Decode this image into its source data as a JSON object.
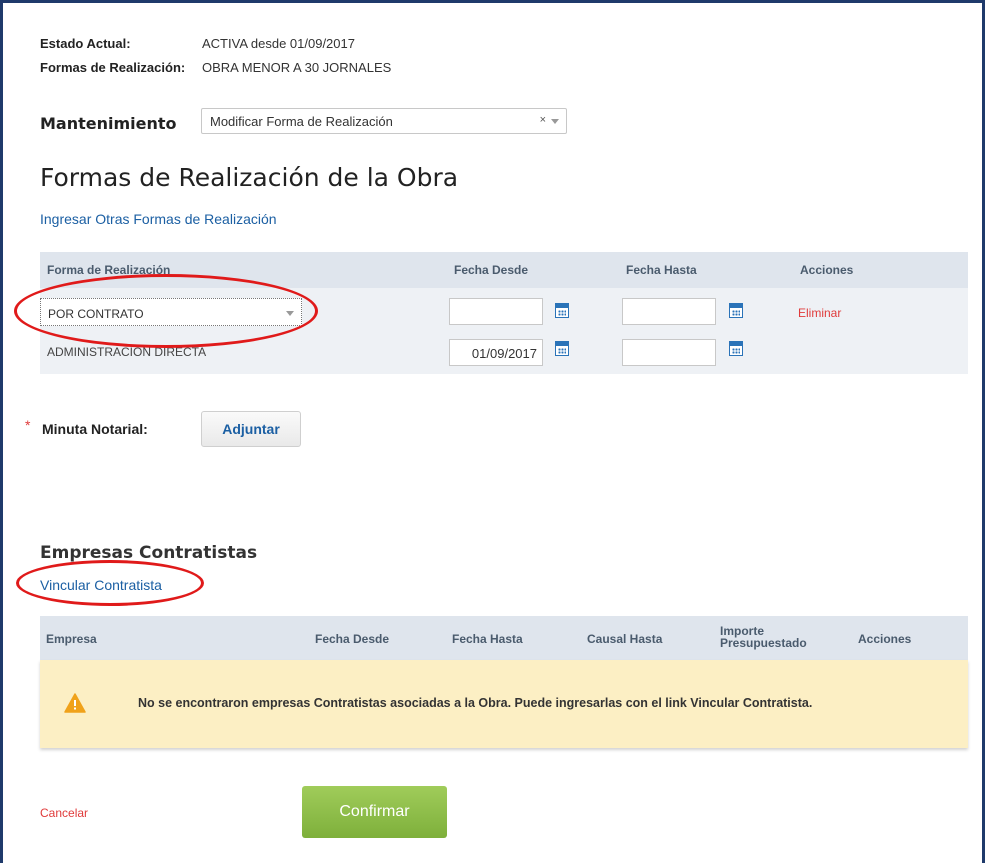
{
  "status": {
    "estado_label": "Estado Actual:",
    "estado_value": "ACTIVA desde 01/09/2017",
    "formas_label": "Formas de Realización:",
    "formas_value": "OBRA MENOR A 30 JORNALES"
  },
  "mantenimiento": {
    "label": "Mantenimiento",
    "selected": "Modificar Forma de Realización",
    "clear_symbol": "×"
  },
  "formas_section": {
    "title": "Formas de Realización de la Obra",
    "add_link": "Ingresar Otras Formas de Realización",
    "columns": [
      "Forma de Realización",
      "Fecha Desde",
      "Fecha Hasta",
      "Acciones"
    ],
    "rows": [
      {
        "forma": "POR CONTRATO",
        "fecha_desde": "",
        "fecha_hasta": "",
        "accion": "Eliminar"
      },
      {
        "forma": "ADMINISTRACIÓN DIRECTA",
        "fecha_desde": "01/09/2017",
        "fecha_hasta": "",
        "accion": ""
      }
    ]
  },
  "minuta": {
    "required_mark": "*",
    "label": "Minuta Notarial:",
    "button": "Adjuntar"
  },
  "empresas": {
    "title": "Empresas Contratistas",
    "link": "Vincular Contratista",
    "columns": [
      "Empresa",
      "Fecha Desde",
      "Fecha Hasta",
      "Causal Hasta",
      "Importe Presupuestado",
      "Acciones"
    ],
    "warning": "No se encontraron empresas Contratistas asociadas a la Obra. Puede ingresarlas con el link Vincular Contratista.",
    "warning_icon": "warning-triangle-icon"
  },
  "footer": {
    "cancel": "Cancelar",
    "confirm": "Confirmar"
  },
  "colors": {
    "accent_link": "#1b5fa3",
    "danger": "#e03b3b",
    "confirm_green": "#8bbd47",
    "warning_bg": "#fcefc4",
    "annotation_red": "#e01a1a"
  }
}
